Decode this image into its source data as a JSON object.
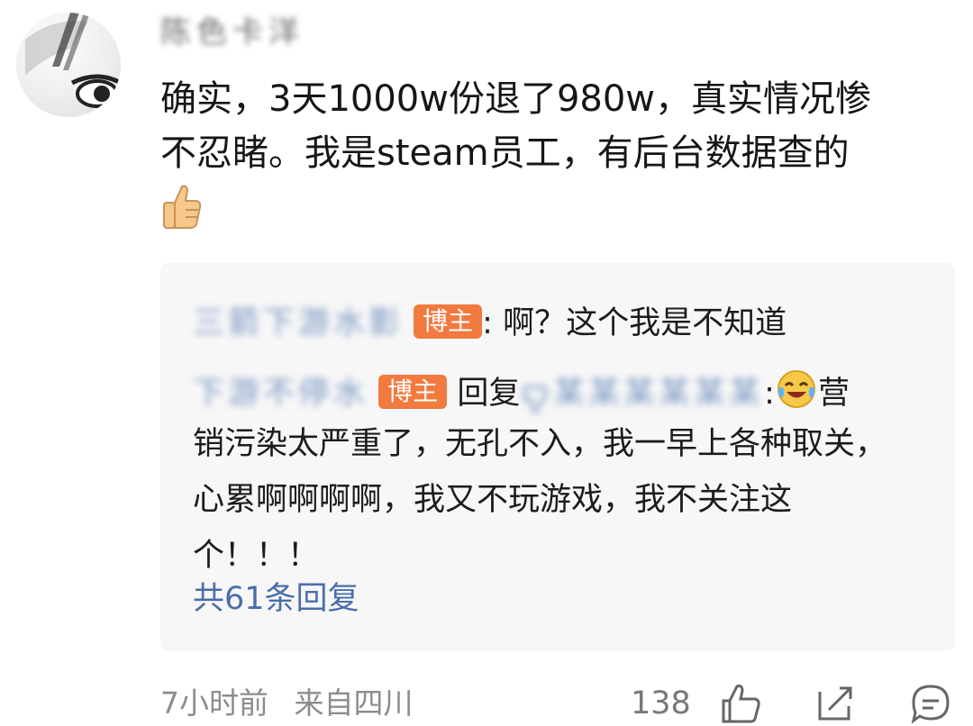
{
  "comment": {
    "username": "陈色卡洋",
    "text": "确实，3天1000w份退了980w，真实情况惨\n不忍睹。我是steam员工，有后台数据查的"
  },
  "reply_box": {
    "reply1": {
      "name": "三箭下游水影",
      "badge": "博主",
      "text": ": 啊？这个我是不知道"
    },
    "reply2": {
      "name": "下游不停水",
      "badge": "博主",
      "reply_label": "回复",
      "reply_to": "ꨄ某某某某某某",
      "colon": ":",
      "text_start": "营",
      "text": "销污染太严重了，无孔不入，我一早上各种取关，\n心累啊啊啊啊，我又不玩游戏，我不关注这\n个！！！"
    },
    "more_replies": "共61条回复"
  },
  "footer": {
    "time": "7小时前",
    "location": "来自四川",
    "likes": "138"
  },
  "colors": {
    "badge": "#f27a3f",
    "link": "#4a6ea9",
    "reply_bg": "#f7f7f8"
  },
  "icons": [
    "thumbs-up-emoji",
    "laughing-crying-emoji",
    "like-icon",
    "share-icon",
    "comment-icon"
  ]
}
